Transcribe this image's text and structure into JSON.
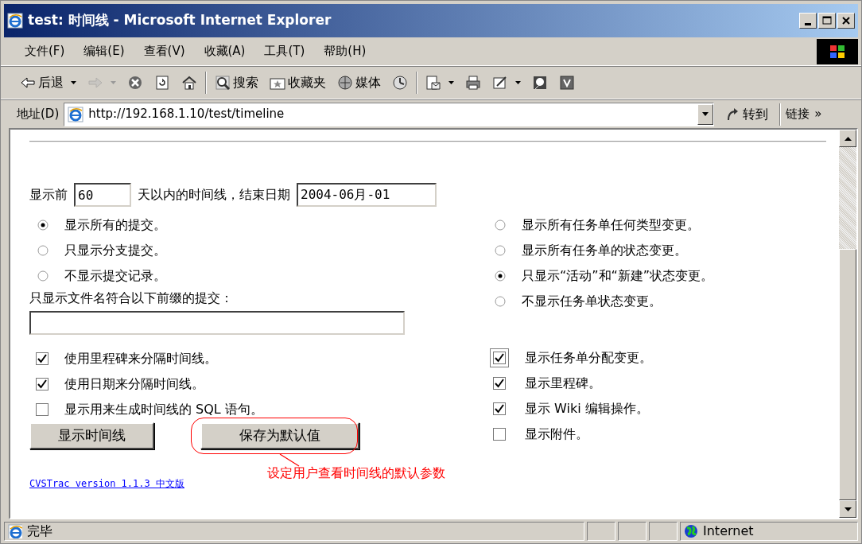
{
  "window": {
    "title": "test: 时间线 - Microsoft Internet Explorer"
  },
  "menu": [
    "文件(F)",
    "编辑(E)",
    "查看(V)",
    "收藏(A)",
    "工具(T)",
    "帮助(H)"
  ],
  "toolbar": [
    {
      "label": "后退",
      "dropdown": true,
      "disabled": false
    },
    {
      "dropdown": true,
      "disabled": true
    },
    {
      "dropdown": false,
      "disabled": false
    },
    {
      "dropdown": false,
      "disabled": false
    },
    {
      "dropdown": false,
      "disabled": false
    },
    {
      "label": "搜索",
      "dropdown": false,
      "disabled": false
    },
    {
      "label": "收藏夹",
      "dropdown": false,
      "disabled": false
    },
    {
      "label": "媒体",
      "dropdown": false,
      "disabled": false
    },
    {
      "dropdown": false,
      "disabled": false
    },
    {
      "dropdown": true,
      "disabled": false
    },
    {
      "dropdown": false,
      "disabled": false
    },
    {
      "dropdown": true,
      "disabled": false
    },
    {
      "dropdown": false,
      "disabled": false
    },
    {
      "dropdown": false,
      "disabled": false
    }
  ],
  "address_bar": {
    "label": "地址(D)",
    "url": "http://192.168.1.10/test/timeline",
    "go": "转到",
    "links": "链接",
    "more": "»"
  },
  "form": {
    "prefix": "显示前",
    "days": "60",
    "middle": "天以内的时间线，结束日期",
    "end_date": "2004-06月-01",
    "commit_options": [
      {
        "label": "显示所有的提交。",
        "selected": true
      },
      {
        "label": "只显示分支提交。",
        "selected": false
      },
      {
        "label": "不显示提交记录。",
        "selected": false
      }
    ],
    "filename_prefix_label": "只显示文件名符合以下前缀的提交：",
    "left_checkboxes": [
      {
        "label": "使用里程碑来分隔时间线。",
        "checked": true
      },
      {
        "label": "使用日期来分隔时间线。",
        "checked": true
      },
      {
        "label": "显示用来生成时间线的 SQL 语句。",
        "checked": false
      }
    ],
    "ticket_options": [
      {
        "label": "显示所有任务单任何类型变更。",
        "selected": false
      },
      {
        "label": "显示所有任务单的状态变更。",
        "selected": false
      },
      {
        "label": "只显示“活动”和“新建”状态变更。",
        "selected": true
      },
      {
        "label": "不显示任务单状态变更。",
        "selected": false
      }
    ],
    "right_checkboxes": [
      {
        "label": "显示任务单分配变更。",
        "checked": true,
        "focused": true
      },
      {
        "label": "显示里程碑。",
        "checked": true,
        "focused": false
      },
      {
        "label": "显示 Wiki 编辑操作。",
        "checked": true,
        "focused": false
      },
      {
        "label": "显示附件。",
        "checked": false,
        "focused": false
      }
    ],
    "buttons": [
      "显示时间线",
      "保存为默认值"
    ],
    "annotation": "设定用户查看时间线的默认参数",
    "footer_link": "CVSTrac version 1.1.3 中文版"
  },
  "status_bar": {
    "text": "完毕",
    "zone": "Internet"
  }
}
